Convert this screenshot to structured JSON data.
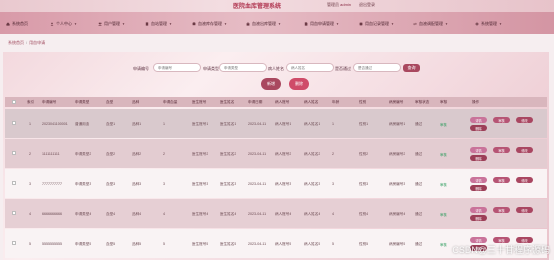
{
  "header": {
    "title": "医院血库管理系统",
    "user_prefix": "管理员",
    "user_name": "admin",
    "logout": "退出登录"
  },
  "nav": [
    {
      "label": "系统首页",
      "icon": "home-icon",
      "caret": false
    },
    {
      "label": "个人中心",
      "icon": "user-icon",
      "caret": true
    },
    {
      "label": "用户管理",
      "icon": "users-icon",
      "caret": true
    },
    {
      "label": "血站管理",
      "icon": "building-icon",
      "caret": true
    },
    {
      "label": "血液库存管理",
      "icon": "database-icon",
      "caret": true
    },
    {
      "label": "血液出库管理",
      "icon": "box-out-icon",
      "caret": true
    },
    {
      "label": "用血申请管理",
      "icon": "document-icon",
      "caret": true
    },
    {
      "label": "用血记录管理",
      "icon": "record-icon",
      "caret": true
    },
    {
      "label": "血液调配管理",
      "icon": "swap-icon",
      "caret": true
    },
    {
      "label": "系统管理",
      "icon": "gear-icon",
      "caret": true
    }
  ],
  "breadcrumb": [
    "系统首页",
    "用血申请"
  ],
  "search": {
    "fields": [
      {
        "label": "申请编号",
        "placeholder": "申请编号"
      },
      {
        "label": "申请类型",
        "placeholder": "申请类型"
      },
      {
        "label": "病人姓名",
        "placeholder": "病人姓名"
      },
      {
        "label": "是否通过",
        "placeholder": "是否通过"
      }
    ],
    "button": "查询"
  },
  "actions": {
    "add": "新增",
    "delete": "删除"
  },
  "colors": {
    "primary": "#a9485f",
    "add_button": "#a9485f",
    "delete_button": "#cf4c69",
    "op_detail": "#c9739a",
    "op_review": "#b65474",
    "op_edit": "#a94661",
    "op_delete": "#9c3e57",
    "status_green": "#2e9d5e"
  },
  "table": {
    "headers": [
      "索引",
      "申请编号",
      "申请类型",
      "血型",
      "品种",
      "申请血量",
      "医生账号",
      "医生姓名",
      "申请日期",
      "病人账号",
      "病人姓名",
      "年龄",
      "性别",
      "病房编号",
      "审核状态",
      "审核",
      "操作"
    ],
    "rows": [
      {
        "index": "1",
        "code": "2023041100001",
        "type": "普通用血",
        "blood": "血型1",
        "variety": "品种1",
        "amount": "1",
        "doc_acc": "医生账号1",
        "doc_name": "医生姓名1",
        "date": "2023-04-11",
        "pat_acc": "病人账号1",
        "pat_name": "病人姓名1",
        "age": "1",
        "sex": "性别1",
        "ward": "病房编号1",
        "status": "通过",
        "audit": "审核"
      },
      {
        "index": "2",
        "code": "1111111111",
        "type": "申请类型2",
        "blood": "血型2",
        "variety": "品种2",
        "amount": "2",
        "doc_acc": "医生账号2",
        "doc_name": "医生姓名2",
        "date": "2023-04-11",
        "pat_acc": "病人账号2",
        "pat_name": "病人姓名2",
        "age": "2",
        "sex": "性别2",
        "ward": "病房编号2",
        "status": "通过",
        "audit": "审核"
      },
      {
        "index": "3",
        "code": "7777777777",
        "type": "申请类型3",
        "blood": "血型3",
        "variety": "品种3",
        "amount": "3",
        "doc_acc": "医生账号3",
        "doc_name": "医生姓名3",
        "date": "2023-04-11",
        "pat_acc": "病人账号3",
        "pat_name": "病人姓名3",
        "age": "3",
        "sex": "性别3",
        "ward": "病房编号3",
        "status": "通过",
        "audit": "审核"
      },
      {
        "index": "4",
        "code": "6666666666",
        "type": "申请类型4",
        "blood": "血型4",
        "variety": "品种4",
        "amount": "4",
        "doc_acc": "医生账号4",
        "doc_name": "医生姓名4",
        "date": "2023-04-11",
        "pat_acc": "病人账号4",
        "pat_name": "病人姓名4",
        "age": "4",
        "sex": "性别4",
        "ward": "病房编号4",
        "status": "通过",
        "audit": "审核"
      },
      {
        "index": "5",
        "code": "5555555555",
        "type": "申请类型5",
        "blood": "血型5",
        "variety": "品种5",
        "amount": "5",
        "doc_acc": "医生账号5",
        "doc_name": "医生姓名5",
        "date": "2023-04-11",
        "pat_acc": "病人账号5",
        "pat_name": "病人姓名5",
        "age": "5",
        "sex": "性别5",
        "ward": "病房编号5",
        "status": "通过",
        "audit": "审核"
      }
    ],
    "op_buttons": [
      "详情",
      "审核",
      "修改",
      "删除"
    ]
  },
  "watermark": "CSDN@三十甘程序源码"
}
